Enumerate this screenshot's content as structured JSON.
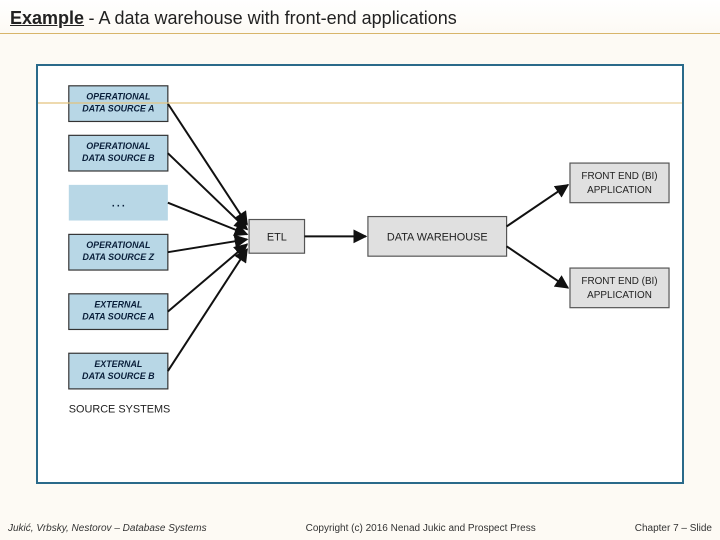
{
  "title": {
    "strong": "Example",
    "rest": " - A data warehouse with front-end applications"
  },
  "diagram": {
    "sources": [
      {
        "line1": "OPERATIONAL",
        "line2": "DATA SOURCE A"
      },
      {
        "line1": "OPERATIONAL",
        "line2": "DATA SOURCE B"
      },
      {
        "dots": "…"
      },
      {
        "line1": "OPERATIONAL",
        "line2": "DATA SOURCE Z"
      },
      {
        "line1": "EXTERNAL",
        "line2": "DATA SOURCE A"
      },
      {
        "line1": "EXTERNAL",
        "line2": "DATA SOURCE B"
      }
    ],
    "source_section_label": "SOURCE SYSTEMS",
    "etl_label": "ETL",
    "dw_label": "DATA WAREHOUSE",
    "frontends": [
      {
        "line1": "FRONT END (BI)",
        "line2": "APPLICATION"
      },
      {
        "line1": "FRONT END (BI)",
        "line2": "APPLICATION"
      }
    ]
  },
  "footer": {
    "left": "Jukić, Vrbsky, Nestorov – Database Systems",
    "mid": "Copyright (c) 2016 Nenad Jukic and Prospect Press",
    "right": "Chapter 7 – Slide"
  }
}
